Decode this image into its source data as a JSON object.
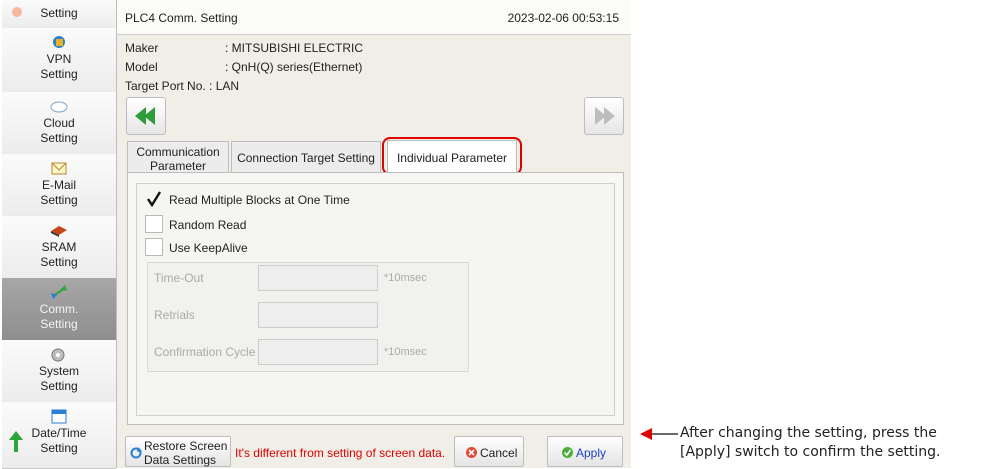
{
  "sidebar": {
    "items": [
      {
        "label_line1": "Setting",
        "label_line2": ""
      },
      {
        "label_line1": "VPN",
        "label_line2": "Setting"
      },
      {
        "label_line1": "Cloud",
        "label_line2": "Setting"
      },
      {
        "label_line1": "E-Mail",
        "label_line2": "Setting"
      },
      {
        "label_line1": "SRAM",
        "label_line2": "Setting"
      },
      {
        "label_line1": "Comm.",
        "label_line2": "Setting"
      },
      {
        "label_line1": "System",
        "label_line2": "Setting"
      },
      {
        "label_line1": "Date/Time",
        "label_line2": "Setting"
      }
    ],
    "active_index": 5
  },
  "header": {
    "title": "PLC4 Comm. Setting",
    "datetime": "2023-02-06  00:53:15"
  },
  "info": {
    "maker_label": "Maker",
    "maker_value": ": MITSUBISHI ELECTRIC",
    "model_label": "Model",
    "model_value": ": QnH(Q) series(Ethernet)",
    "port_label": "Target Port No.",
    "port_value": ": LAN"
  },
  "tabs": {
    "comm_line1": "Communication",
    "comm_line2": "Parameter",
    "connection": "Connection Target Setting",
    "individual": "Individual Parameter",
    "selected": "Individual Parameter"
  },
  "options": {
    "read_multiple": {
      "label": "Read Multiple Blocks at One Time",
      "checked": true
    },
    "random_read": {
      "label": "Random Read",
      "checked": false
    },
    "use_keepalive": {
      "label": "Use KeepAlive",
      "checked": false
    }
  },
  "keepalive": {
    "timeout_label": "Time-Out",
    "timeout_value": "",
    "timeout_unit": "*10msec",
    "retrials_label": "Retrials",
    "retrials_value": "",
    "confirm_label": "Confirmation Cycle",
    "confirm_value": "",
    "confirm_unit": "*10msec"
  },
  "bottom": {
    "restore_line1": "Restore Screen",
    "restore_line2": "Data Settings",
    "message": "It's different from setting of screen data.",
    "cancel": "Cancel",
    "apply": "Apply"
  },
  "annotation": {
    "line1": "After changing the setting, press the",
    "line2": "[Apply] switch to confirm the setting."
  },
  "colors": {
    "highlight": "#e00000",
    "nav_arrow": "#2f9b3a",
    "message": "#e00000",
    "apply_text": "#1a3fc8"
  },
  "icons": {
    "prev": "double-left-arrow-icon",
    "next": "double-right-arrow-icon",
    "scroll_down": "green-down-arrow-icon",
    "scroll_up": "green-up-arrow-icon"
  }
}
